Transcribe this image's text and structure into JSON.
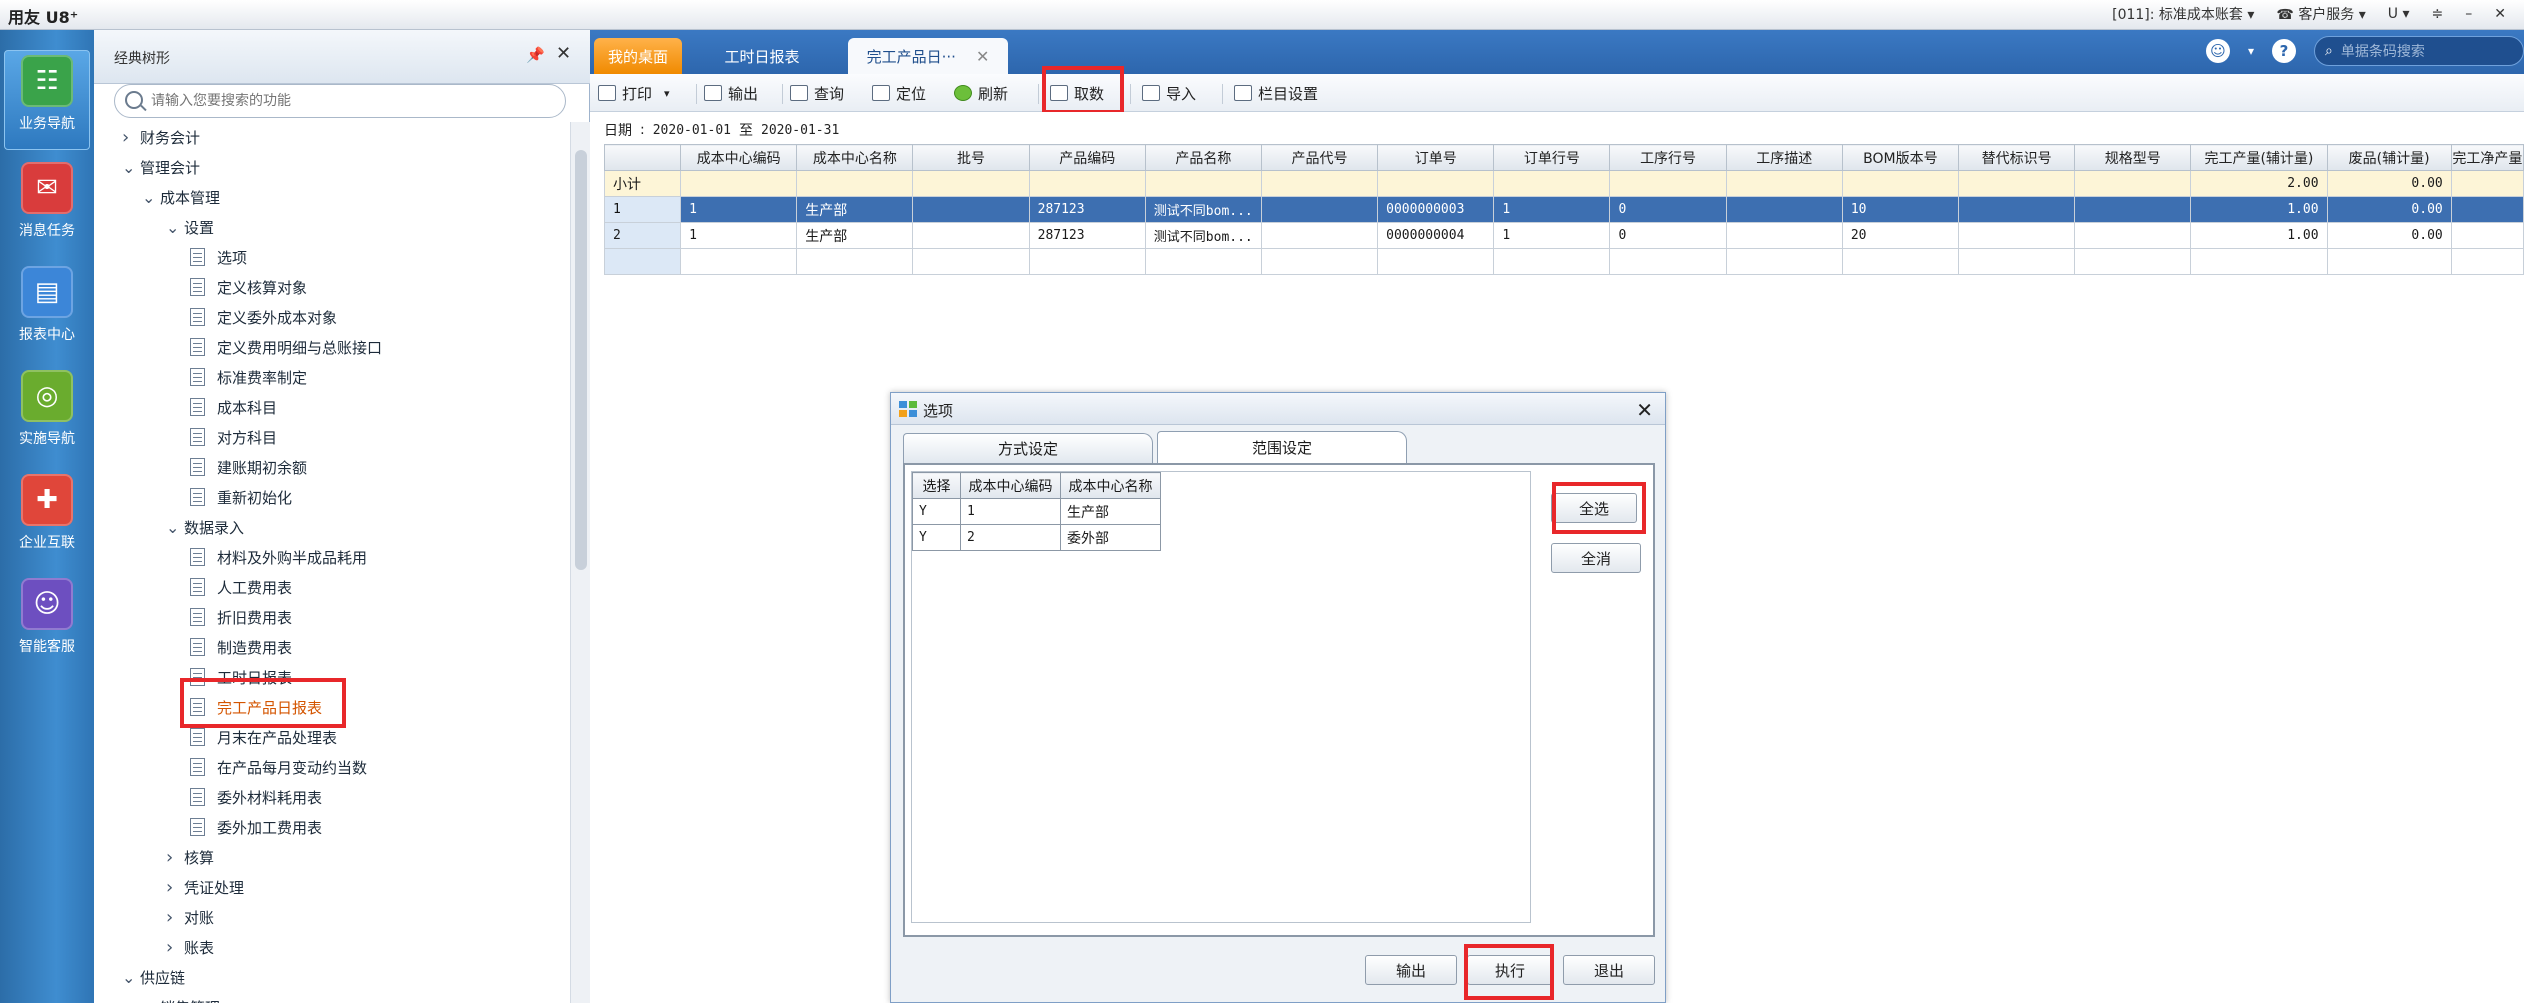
{
  "app": {
    "title": "用友 U8⁺",
    "account": "[011]: 标准成本账套",
    "service": "客户服务",
    "u_icon": "U"
  },
  "nav": [
    {
      "label": "业务导航",
      "icon": "grid-icon",
      "color": "#3aa34a"
    },
    {
      "label": "消息任务",
      "icon": "message-icon",
      "color": "#d93c3c"
    },
    {
      "label": "报表中心",
      "icon": "report-icon",
      "color": "#3c86d8"
    },
    {
      "label": "实施导航",
      "icon": "compass-icon",
      "color": "#6aac2e"
    },
    {
      "label": "企业互联",
      "icon": "link-icon",
      "color": "#e0463a"
    },
    {
      "label": "智能客服",
      "icon": "service-icon",
      "color": "#6d4fc0"
    }
  ],
  "tree": {
    "title": "经典树形",
    "search_placeholder": "请输入您要搜索的功能",
    "nodes": [
      {
        "label": "财务会计",
        "kind": "collapsed",
        "level": 0
      },
      {
        "label": "管理会计",
        "kind": "expanded",
        "level": 0
      },
      {
        "label": "成本管理",
        "kind": "expanded",
        "level": 1
      },
      {
        "label": "设置",
        "kind": "expanded",
        "level": 2
      },
      {
        "label": "选项",
        "kind": "leaf",
        "level": 3
      },
      {
        "label": "定义核算对象",
        "kind": "leaf",
        "level": 3
      },
      {
        "label": "定义委外成本对象",
        "kind": "leaf",
        "level": 3
      },
      {
        "label": "定义费用明细与总账接口",
        "kind": "leaf",
        "level": 3
      },
      {
        "label": "标准费率制定",
        "kind": "leaf",
        "level": 3
      },
      {
        "label": "成本科目",
        "kind": "leaf",
        "level": 3
      },
      {
        "label": "对方科目",
        "kind": "leaf",
        "level": 3
      },
      {
        "label": "建账期初余额",
        "kind": "leaf",
        "level": 3
      },
      {
        "label": "重新初始化",
        "kind": "leaf",
        "level": 3
      },
      {
        "label": "数据录入",
        "kind": "expanded",
        "level": 2
      },
      {
        "label": "材料及外购半成品耗用",
        "kind": "leaf",
        "level": 3
      },
      {
        "label": "人工费用表",
        "kind": "leaf",
        "level": 3
      },
      {
        "label": "折旧费用表",
        "kind": "leaf",
        "level": 3
      },
      {
        "label": "制造费用表",
        "kind": "leaf",
        "level": 3
      },
      {
        "label": "工时日报表",
        "kind": "leaf",
        "level": 3
      },
      {
        "label": "完工产品日报表",
        "kind": "leaf",
        "level": 3,
        "selected": true
      },
      {
        "label": "月末在产品处理表",
        "kind": "leaf",
        "level": 3
      },
      {
        "label": "在产品每月变动约当数",
        "kind": "leaf",
        "level": 3
      },
      {
        "label": "委外材料耗用表",
        "kind": "leaf",
        "level": 3
      },
      {
        "label": "委外加工费用表",
        "kind": "leaf",
        "level": 3
      },
      {
        "label": "核算",
        "kind": "collapsed",
        "level": 2
      },
      {
        "label": "凭证处理",
        "kind": "collapsed",
        "level": 2
      },
      {
        "label": "对账",
        "kind": "collapsed",
        "level": 2
      },
      {
        "label": "账表",
        "kind": "collapsed",
        "level": 2
      },
      {
        "label": "供应链",
        "kind": "expanded",
        "level": 0
      },
      {
        "label": "销售管理",
        "kind": "collapsed",
        "level": 1
      }
    ]
  },
  "tabs": {
    "desk": "我的桌面",
    "hours": "工时日报表",
    "report": "完工产品日···",
    "search_placeholder": "单据条码搜索"
  },
  "toolbar": {
    "print": "打印",
    "export": "输出",
    "query": "查询",
    "locate": "定位",
    "refresh": "刷新",
    "fetch": "取数",
    "import": "导入",
    "columns": "栏目设置"
  },
  "date": {
    "label": "日期",
    "sep": ":",
    "from": "2020-01-01",
    "to_word": "至",
    "to": "2020-01-31"
  },
  "grid": {
    "headers": [
      "",
      "成本中心编码",
      "成本中心名称",
      "批号",
      "产品编码",
      "产品名称",
      "产品代号",
      "订单号",
      "订单行号",
      "工序行号",
      "工序描述",
      "BOM版本号",
      "替代标识号",
      "规格型号",
      "完工产量(辅计量)",
      "废品(辅计量)",
      "完工净产量"
    ],
    "subtotal": {
      "label": "小计",
      "qty": "2.00",
      "scrap": "0.00"
    },
    "rows": [
      {
        "no": "1",
        "center_code": "1",
        "center_name": "生产部",
        "batch": "",
        "product_code": "287123",
        "product_name": "测试不同bom...",
        "product_alias": "",
        "order_no": "0000000003",
        "order_line": "1",
        "process_line": "0",
        "process_desc": "",
        "bom": "10",
        "alt": "",
        "spec": "",
        "qty": "1.00",
        "scrap": "0.00"
      },
      {
        "no": "2",
        "center_code": "1",
        "center_name": "生产部",
        "batch": "",
        "product_code": "287123",
        "product_name": "测试不同bom...",
        "product_alias": "",
        "order_no": "0000000004",
        "order_line": "1",
        "process_line": "0",
        "process_desc": "",
        "bom": "20",
        "alt": "",
        "spec": "",
        "qty": "1.00",
        "scrap": "0.00"
      }
    ]
  },
  "dialog": {
    "title": "选项",
    "tab1": "方式设定",
    "tab2": "范围设定",
    "headers": [
      "选择",
      "成本中心编码",
      "成本中心名称"
    ],
    "rows": [
      {
        "sel": "Y",
        "code": "1",
        "name": "生产部"
      },
      {
        "sel": "Y",
        "code": "2",
        "name": "委外部"
      }
    ],
    "select_all": "全选",
    "clear_all": "全消",
    "export": "输出",
    "execute": "执行",
    "exit": "退出"
  }
}
